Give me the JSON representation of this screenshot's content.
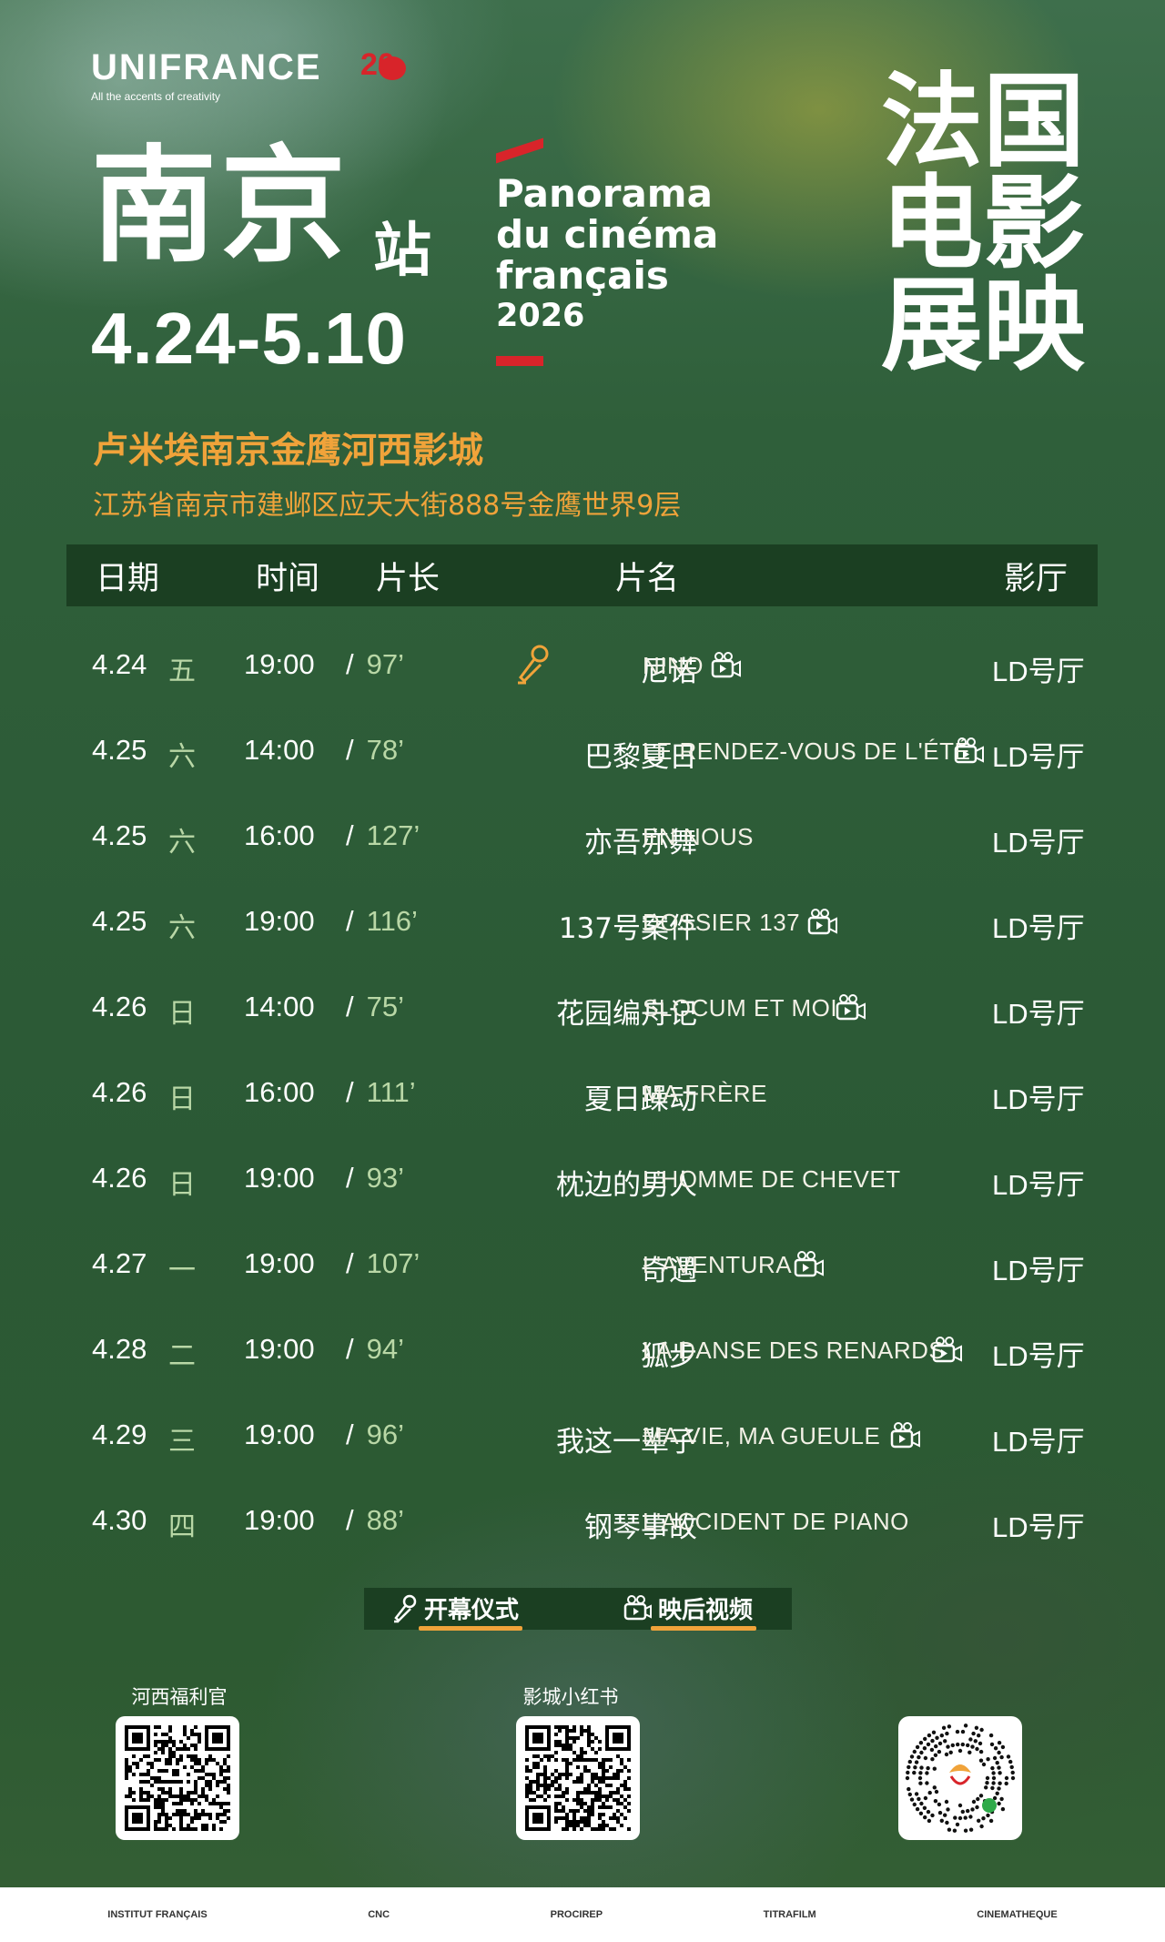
{
  "header": {
    "brand": "UNIFRANCE",
    "brand_tagline": "All the accents of creativity",
    "anniversary": "20",
    "city": "南京",
    "station": "站",
    "dates": "4.24-5.10",
    "festival_line1": "Panorama",
    "festival_line2": "du cinéma",
    "festival_line3": "français",
    "festival_year": "2026",
    "title_cn_1": "法国",
    "title_cn_2": "电影",
    "title_cn_3": "展映"
  },
  "venue": {
    "name": "卢米埃南京金鹰河西影城",
    "address": "江苏省南京市建邺区应天大街888号金鹰世界9层"
  },
  "table": {
    "headers": {
      "date": "日期",
      "time": "时间",
      "length": "片长",
      "title": "片名",
      "hall": "影厅"
    },
    "rows": [
      {
        "date": "4.24",
        "weekday": "五",
        "time": "19:00",
        "sep": "/",
        "length": "97’",
        "title_cn": "尼诺",
        "title_fr": "NINO",
        "mic": true,
        "cam": true,
        "hall": "LD号厅"
      },
      {
        "date": "4.25",
        "weekday": "六",
        "time": "14:00",
        "sep": "/",
        "length": "78’",
        "title_cn": "巴黎夏日",
        "title_fr": "LE RENDEZ-VOUS DE L'ÉTÉ",
        "mic": false,
        "cam": true,
        "hall": "LD号厅"
      },
      {
        "date": "4.25",
        "weekday": "六",
        "time": "16:00",
        "sep": "/",
        "length": "127’",
        "title_cn": "亦吾亦舞",
        "title_fr": "EN NOUS",
        "mic": false,
        "cam": false,
        "hall": "LD号厅"
      },
      {
        "date": "4.25",
        "weekday": "六",
        "time": "19:00",
        "sep": "/",
        "length": "116’",
        "title_cn": "137号案件",
        "title_fr": "DOSSIER 137",
        "mic": false,
        "cam": true,
        "hall": "LD号厅"
      },
      {
        "date": "4.26",
        "weekday": "日",
        "time": "14:00",
        "sep": "/",
        "length": "75’",
        "title_cn": "花园编舟记",
        "title_fr": "SLOCUM ET MOI",
        "mic": false,
        "cam": true,
        "hall": "LD号厅"
      },
      {
        "date": "4.26",
        "weekday": "日",
        "time": "16:00",
        "sep": "/",
        "length": "111’",
        "title_cn": "夏日躁动",
        "title_fr": "MA FRÈRE",
        "mic": false,
        "cam": false,
        "hall": "LD号厅"
      },
      {
        "date": "4.26",
        "weekday": "日",
        "time": "19:00",
        "sep": "/",
        "length": "93’",
        "title_cn": "枕边的男人",
        "title_fr": "L'HOMME DE CHEVET",
        "mic": false,
        "cam": false,
        "hall": "LD号厅"
      },
      {
        "date": "4.27",
        "weekday": "一",
        "time": "19:00",
        "sep": "/",
        "length": "107’",
        "title_cn": "奇遇",
        "title_fr": "L'AVENTURA",
        "mic": false,
        "cam": true,
        "hall": "LD号厅"
      },
      {
        "date": "4.28",
        "weekday": "二",
        "time": "19:00",
        "sep": "/",
        "length": "94’",
        "title_cn": "狐步",
        "title_fr": "LA DANSE DES RENARDS",
        "mic": false,
        "cam": true,
        "hall": "LD号厅"
      },
      {
        "date": "4.29",
        "weekday": "三",
        "time": "19:00",
        "sep": "/",
        "length": "96’",
        "title_cn": "我这一辈子",
        "title_fr": "MA VIE, MA GUEULE",
        "mic": false,
        "cam": true,
        "hall": "LD号厅"
      },
      {
        "date": "4.30",
        "weekday": "四",
        "time": "19:00",
        "sep": "/",
        "length": "88’",
        "title_cn": "钢琴事故",
        "title_fr": "L'ACCIDENT DE PIANO",
        "mic": false,
        "cam": false,
        "hall": "LD号厅"
      }
    ]
  },
  "legend": {
    "opening": "开幕仪式",
    "post_video": "映后视频"
  },
  "qr": {
    "left_label": "河西福利官",
    "middle_label": "影城小红书"
  },
  "sponsors": [
    "INSTITUT FRANÇAIS",
    "CNC",
    "PROCIREP",
    "TITRAFILM",
    "CINEMATHEQUE"
  ],
  "colors": {
    "accent": "#f0a33a",
    "red": "#d8242a",
    "header_bar": "#1b3f22",
    "green_bg": "#2c5a33"
  }
}
